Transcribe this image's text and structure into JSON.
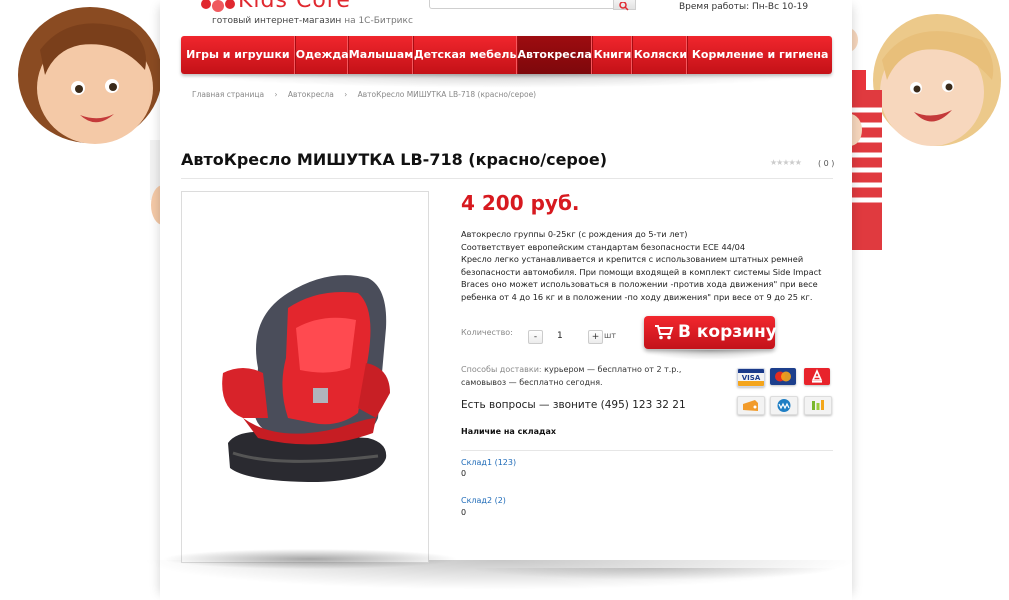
{
  "header": {
    "logo_text": "Kids Core",
    "tagline": "готовый интернет-магазин",
    "tagline_suffix": "на 1С-Битрикс",
    "worktime": "Время работы: Пн-Вс 10-19"
  },
  "nav": {
    "items": [
      {
        "label": "Игры и игрушки"
      },
      {
        "label": "Одежда"
      },
      {
        "label": "Малышам"
      },
      {
        "label": "Детская мебель"
      },
      {
        "label": "Автокресла"
      },
      {
        "label": "Книги"
      },
      {
        "label": "Коляски"
      },
      {
        "label": "Кормление и гигиена"
      }
    ],
    "active": "Автокресла"
  },
  "breadcrumb": {
    "items": [
      "Главная страница",
      "Автокресла",
      "АвтоКресло МИШУТКА LB-718 (красно/серое)"
    ],
    "separator": "›"
  },
  "product": {
    "title": "АвтоКресло МИШУТКА LB-718 (красно/серое)",
    "rating_count": "( 0 )",
    "price": "4 200 руб.",
    "description": [
      "Автокресло группы 0-25кг (с рождения до 5-ти лет)",
      "Соответствует европейским стандартам безопасности ЕСЕ 44/04",
      "Кресло легко устанавливается и крепится с использованием штатных ремней безопасности автомобиля. При помощи входящей в комплект системы Side Impact Braces оно может использоваться в положении -против хода движения\" при весе ребенка от 4 до 16 кг и в положении -по ходу движения\" при весе от 9 до 25 кг."
    ],
    "quantity_label": "Количество:",
    "quantity_value": "1",
    "quantity_unit": "шт",
    "minus": "-",
    "plus": "+",
    "cart_button": "В корзину",
    "delivery_label": "Способы доставки:",
    "delivery_text": "курьером — бесплатно от 2 т.р., самовывоз — бесплатно сегодня.",
    "phone_text": "Есть вопросы — звоните (495) 123 32 21",
    "payment_icons": [
      "visa-icon",
      "mastercard-icon",
      "alfa-bank-icon",
      "yandex-money-icon",
      "webmoney-icon",
      "qiwi-icon"
    ]
  },
  "stock": {
    "title": "Наличие на складах",
    "stores": [
      {
        "name": "Склад1 (123)",
        "value": "0"
      },
      {
        "name": "Склад2 (2)",
        "value": "0"
      }
    ]
  },
  "colors": {
    "brand_red": "#d7191f",
    "nav_active": "#8a0a0e",
    "link_blue": "#1f6bb8"
  }
}
